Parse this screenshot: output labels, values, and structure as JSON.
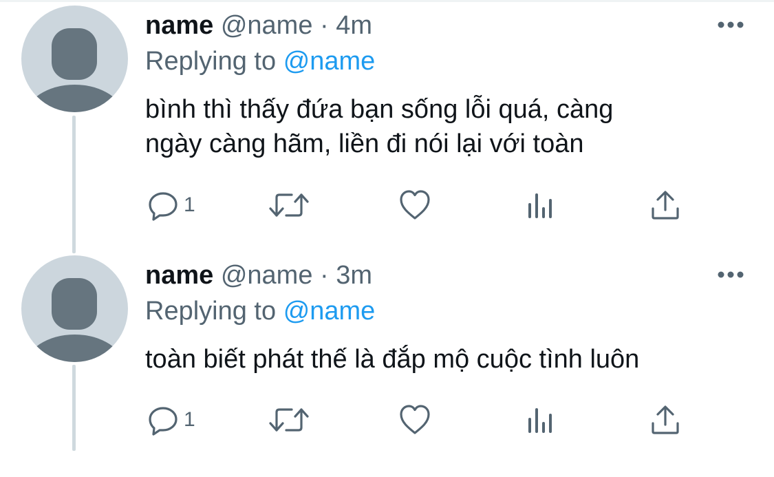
{
  "colors": {
    "accent": "#1d9bf0",
    "secondary_text": "#536471",
    "primary_text": "#0f1419",
    "avatar_bg": "#ccd6dd",
    "avatar_fg": "#66757f",
    "thread_line": "#cfd9de"
  },
  "tweets": [
    {
      "display_name": "name",
      "handle": "@name",
      "separator": "·",
      "time": "4m",
      "replying_prefix": "Replying to",
      "replying_to": "@name",
      "text_lines": [
        "bình thì thấy đứa bạn sống lỗi quá, càng",
        "ngày càng hãm, liền đi nói lại với toàn"
      ],
      "reply_count": "1",
      "icons": {
        "more": "more-horizontal-icon",
        "reply": "reply-icon",
        "retweet": "retweet-icon",
        "like": "like-icon",
        "views": "analytics-icon",
        "share": "share-icon"
      }
    },
    {
      "display_name": "name",
      "handle": "@name",
      "separator": "·",
      "time": "3m",
      "replying_prefix": "Replying to",
      "replying_to": "@name",
      "text_lines": [
        "toàn biết phát thế là đắp mộ cuộc tình luôn"
      ],
      "reply_count": "1",
      "icons": {
        "more": "more-horizontal-icon",
        "reply": "reply-icon",
        "retweet": "retweet-icon",
        "like": "like-icon",
        "views": "analytics-icon",
        "share": "share-icon"
      }
    }
  ]
}
